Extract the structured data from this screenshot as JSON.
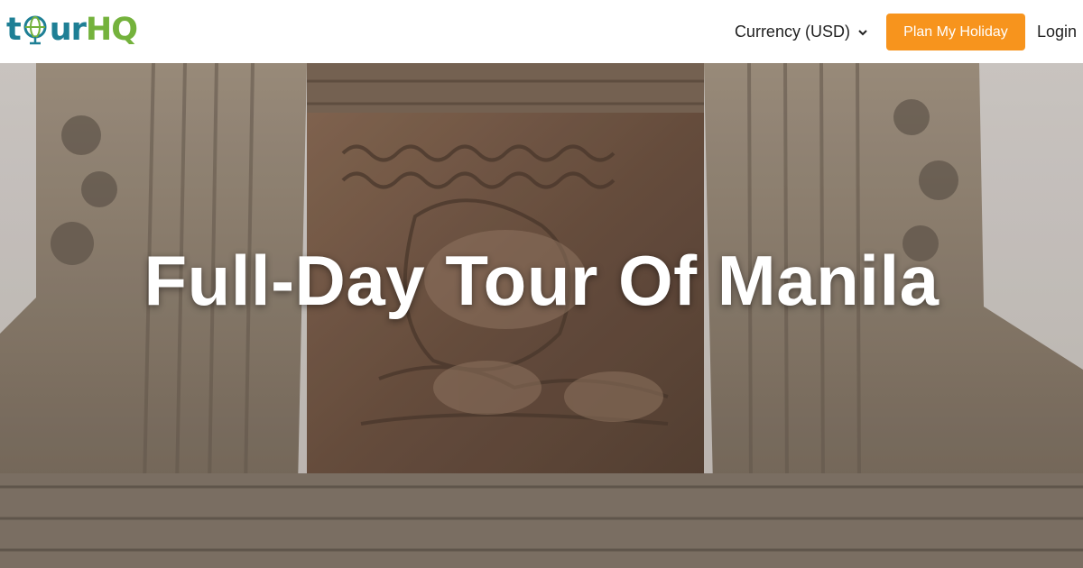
{
  "brand": {
    "logo_part1": "tour",
    "logo_part2": "HQ"
  },
  "nav": {
    "currency_label": "Currency (USD)",
    "plan_button": "Plan My Holiday",
    "login": "Login"
  },
  "hero": {
    "title": "Full-Day Tour Of Manila"
  },
  "colors": {
    "accent": "#f7941d",
    "logo_blue": "#1e7f95",
    "logo_green": "#74b23c"
  },
  "icons": {
    "currency_dropdown": "chevron-down-icon",
    "logo_mark": "globe-icon"
  }
}
